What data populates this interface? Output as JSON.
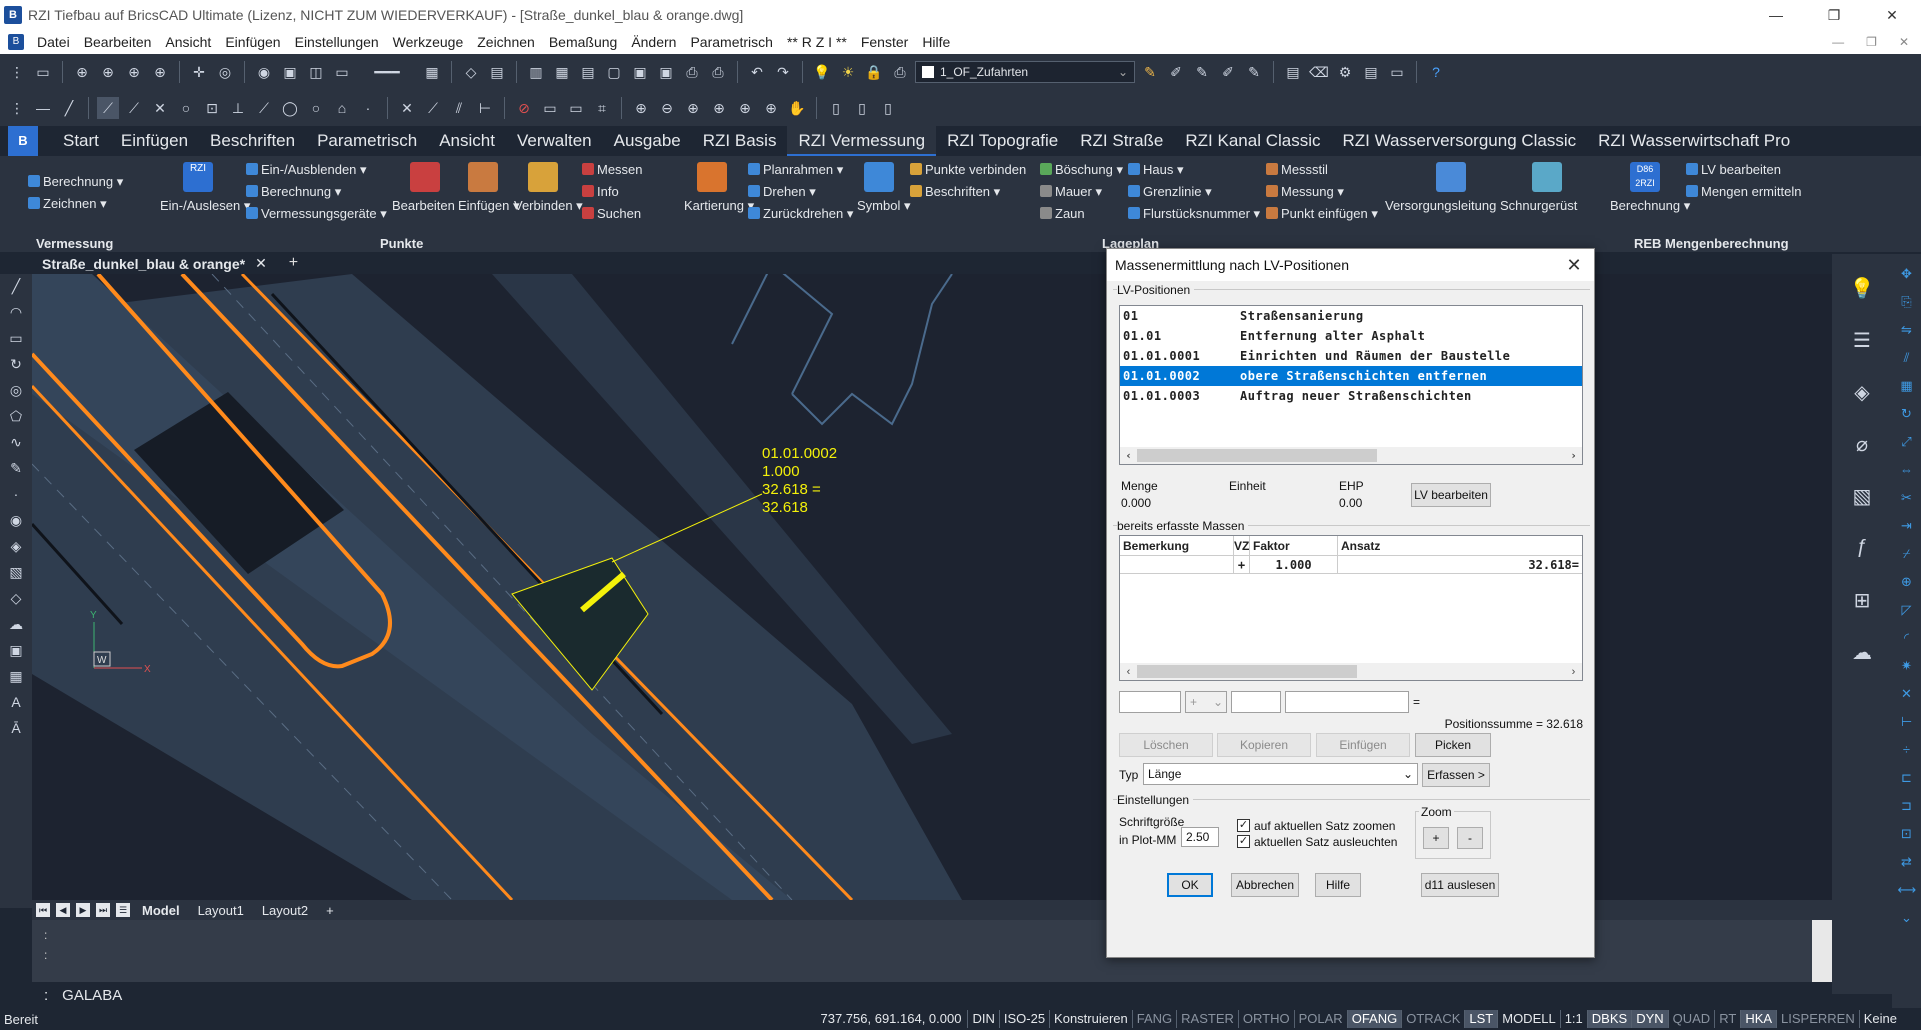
{
  "window": {
    "title": "RZI Tiefbau auf BricsCAD Ultimate (Lizenz, NICHT ZUM WIEDERVERKAUF) - [Straße_dunkel_blau & orange.dwg]",
    "controls": [
      "—",
      "❐",
      "✕"
    ]
  },
  "menu": [
    "Datei",
    "Bearbeiten",
    "Ansicht",
    "Einfügen",
    "Einstellungen",
    "Werkzeuge",
    "Zeichnen",
    "Bemaßung",
    "Ändern",
    "Parametrisch",
    "** R Z I **",
    "Fenster",
    "Hilfe"
  ],
  "menu_right": [
    "—",
    "❐",
    "✕"
  ],
  "layer_combo": "1_OF_Zufahrten",
  "ribbon_tabs": [
    "Start",
    "Einfügen",
    "Beschriften",
    "Parametrisch",
    "Ansicht",
    "Verwalten",
    "Ausgabe",
    "RZI Basis",
    "RZI Vermessung",
    "RZI Topografie",
    "RZI Straße",
    "RZI Kanal Classic",
    "RZI Wasserversorgung Classic",
    "RZI Wasserwirtschaft Pro"
  ],
  "ribbon": {
    "berechnung": "Berechnung",
    "zeichnen": "Zeichnen",
    "group_vermessung": "Vermessung",
    "ein_auslesen": "Ein-/Auslesen",
    "ein_ausblenden": "Ein-/Ausblenden",
    "berechnung2": "Berechnung",
    "vermessungsgeraete": "Vermessungsgeräte",
    "bearbeiten": "Bearbeiten",
    "einfuegen": "Einfügen",
    "verbinden": "Verbinden",
    "messen": "Messen",
    "info": "Info",
    "suchen": "Suchen",
    "group_punkte": "Punkte",
    "kartierung": "Kartierung",
    "planrahmen": "Planrahmen",
    "drehen": "Drehen",
    "zurueckdrehen": "Zurückdrehen",
    "symbol": "Symbol",
    "punkte_verbinden": "Punkte verbinden",
    "beschriften": "Beschriften",
    "boeschung": "Böschung",
    "mauer": "Mauer",
    "zaun": "Zaun",
    "haus": "Haus",
    "grenzlinie": "Grenzlinie",
    "flurstuecksnummer": "Flurstücksnummer",
    "messstil": "Messstil",
    "messung": "Messung",
    "punkt_einfuegen": "Punkt einfügen",
    "versorgungsleitung": "Versorgungsleitung",
    "schnurgeruest": "Schnurgerüst",
    "group_lageplan": "Lageplan",
    "berechnung3": "Berechnung",
    "lv_bearbeiten": "LV bearbeiten",
    "mengen_ermitteln": "Mengen ermitteln",
    "group_reb": "REB Mengenberechnung",
    "rzi_badge": "RZI",
    "d86_badge": "D86\n2RZI"
  },
  "doc_tab": "Straße_dunkel_blau & orange*",
  "doc_tab_close": "✕",
  "doc_tab_add": "+",
  "canvas": {
    "label_lines": [
      "01.01.0002",
      "1.000",
      "32.618 =",
      "32.618"
    ],
    "ucs_x": "X",
    "ucs_y": "Y",
    "ucs_w": "W"
  },
  "model_tabs": [
    "Model",
    "Layout1",
    "Layout2",
    "+"
  ],
  "cmd_history": [
    ":",
    ":"
  ],
  "cmd_prompt": ":",
  "cmd_text": "GALABA",
  "status": {
    "ready": "Bereit",
    "coords": "737.756, 691.164, 0.000",
    "items": [
      {
        "t": "DIN",
        "s": "norm"
      },
      {
        "t": "ISO-25",
        "s": "norm"
      },
      {
        "t": "Konstruieren",
        "s": "norm"
      },
      {
        "t": "FANG",
        "s": "off"
      },
      {
        "t": "RASTER",
        "s": "off"
      },
      {
        "t": "ORTHO",
        "s": "off"
      },
      {
        "t": "POLAR",
        "s": "off"
      },
      {
        "t": "OFANG",
        "s": "on"
      },
      {
        "t": "OTRACK",
        "s": "off"
      },
      {
        "t": "LST",
        "s": "on"
      },
      {
        "t": "MODELL",
        "s": "norm"
      },
      {
        "t": "1:1",
        "s": "norm"
      },
      {
        "t": "DBKS",
        "s": "on"
      },
      {
        "t": "DYN",
        "s": "on"
      },
      {
        "t": "QUAD",
        "s": "off"
      },
      {
        "t": "RT",
        "s": "off"
      },
      {
        "t": "HKA",
        "s": "on"
      },
      {
        "t": "LISPERREN",
        "s": "off"
      },
      {
        "t": "Keine",
        "s": "norm"
      }
    ]
  },
  "dialog": {
    "title": "Massenermittlung nach LV-Positionen",
    "lv_group": "LV-Positionen",
    "lv_rows": [
      {
        "code": "01",
        "text": "Straßensanierung"
      },
      {
        "code": "01.01",
        "text": "Entfernung alter Asphalt"
      },
      {
        "code": "01.01.0001",
        "text": "Einrichten und Räumen der Baustelle"
      },
      {
        "code": "01.01.0002",
        "text": "obere Straßenschichten entfernen"
      },
      {
        "code": "01.01.0003",
        "text": "Auftrag neuer Straßenschichten"
      }
    ],
    "menge_label": "Menge",
    "menge_value": "0.000",
    "einheit_label": "Einheit",
    "ehp_label": "EHP",
    "ehp_value": "0.00",
    "lv_bearbeiten": "LV bearbeiten",
    "massen_group": "bereits erfasste Massen",
    "grid_headers": [
      "Bemerkung",
      "VZ",
      "Faktor",
      "Ansatz"
    ],
    "grid_row": [
      "",
      "+",
      "1.000",
      "32.618="
    ],
    "vz_select": "+",
    "equals": "=",
    "positionssumme": "Positionssumme = 32.618",
    "loeschen": "Löschen",
    "kopieren": "Kopieren",
    "einfuegen": "Einfügen",
    "picken": "Picken",
    "typ_label": "Typ",
    "typ_value": "Länge",
    "erfassen": "Erfassen >",
    "einstellungen_group": "Einstellungen",
    "schriftgroesse": "Schriftgröße",
    "in_plot_mm": "in Plot-MM",
    "schrift_value": "2.50",
    "chk_zoom": "auf aktuellen Satz zoomen",
    "chk_leuchten": "aktuellen Satz ausleuchten",
    "zoom_label": "Zoom",
    "zoom_plus": "+",
    "zoom_minus": "-",
    "ok": "OK",
    "abbrechen": "Abbrechen",
    "hilfe": "Hilfe",
    "d11": "d11 auslesen"
  },
  "colors": {
    "accent": "#0078d7",
    "orange": "#ff8a1c",
    "yellow": "#f4f10a",
    "canvas_bg": "#1d2330",
    "road_fill": "#2f3d4f"
  }
}
